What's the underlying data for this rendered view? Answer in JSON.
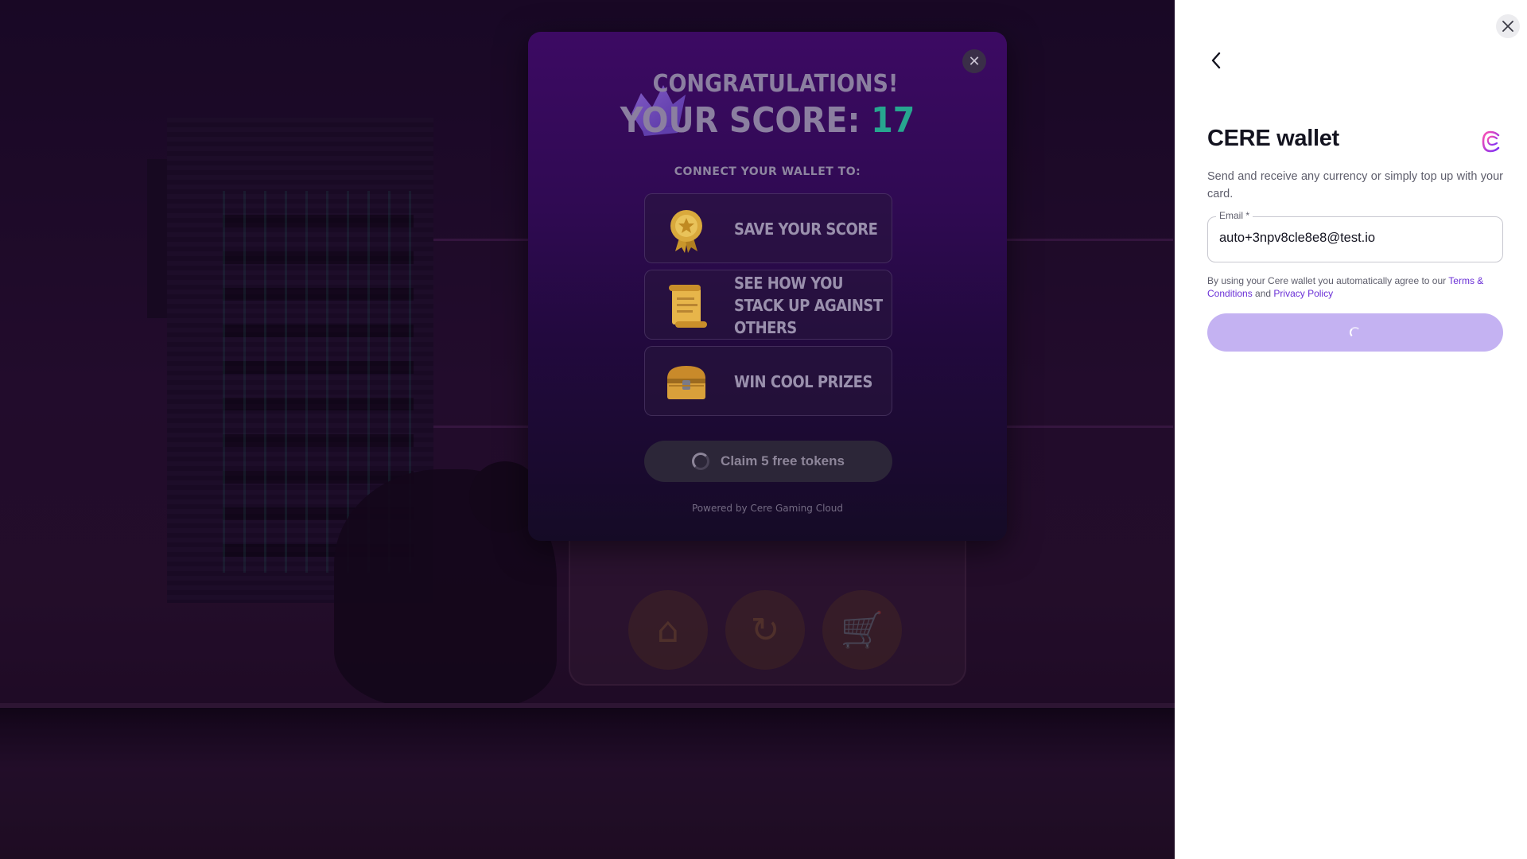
{
  "game": {
    "toolbar_icons": [
      "home-icon",
      "restart-icon",
      "cart-icon"
    ]
  },
  "congrats": {
    "title": "CONGRATULATIONS!",
    "score_label": "YOUR SCORE:",
    "score_value": "17",
    "connect_label": "CONNECT YOUR WALLET TO:",
    "perks": [
      {
        "icon": "medal-icon",
        "label": "SAVE YOUR SCORE"
      },
      {
        "icon": "scroll-icon",
        "label": "SEE HOW YOU STACK UP AGAINST OTHERS"
      },
      {
        "icon": "treasure-chest-icon",
        "label": "WIN COOL PRIZES"
      }
    ],
    "claim_label": "Claim 5 free tokens",
    "powered_by": "Powered by Cere Gaming Cloud",
    "close_glyph": "✕"
  },
  "wallet": {
    "title": "CERE wallet",
    "description": "Send and receive any currency or simply top up with your card.",
    "email_label": "Email *",
    "email_value": "auto+3npv8cle8e8@test.io",
    "terms_prefix": "By using your Cere wallet you automatically agree to our ",
    "terms_link": "Terms & Conditions",
    "terms_and": " and ",
    "privacy_link": "Privacy Policy",
    "accent_color": "#6a2fd6",
    "button_color": "#c4b2f2"
  }
}
